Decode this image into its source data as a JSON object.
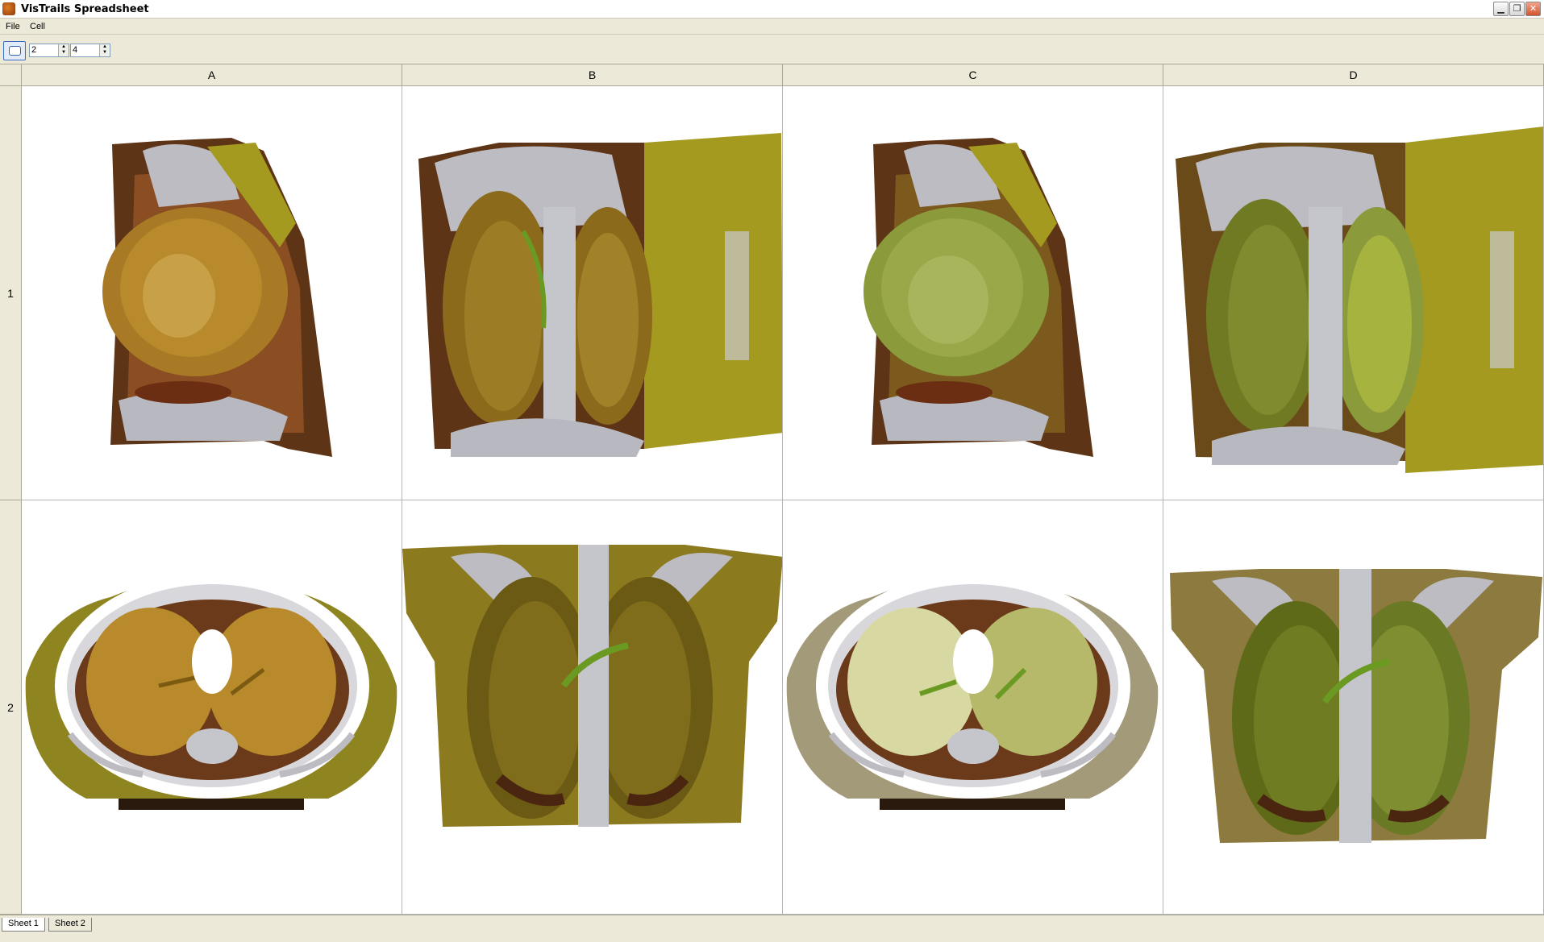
{
  "window": {
    "title": "VisTrails Spreadsheet"
  },
  "menu": [
    "File",
    "Cell"
  ],
  "toolbar": {
    "rows_value": "2",
    "cols_value": "4"
  },
  "grid": {
    "columns": [
      "A",
      "B",
      "C",
      "D"
    ],
    "rows": [
      "1",
      "2"
    ]
  },
  "tabs": [
    {
      "label": "Sheet 1",
      "active": true
    },
    {
      "label": "Sheet 2",
      "active": false
    }
  ],
  "colors": {
    "skin_olive": "#a39a1f",
    "lung_amber": "#b88a2b",
    "lung_green": "#8b9a3b",
    "bone_gray": "#bcbcc2",
    "flesh_brown": "#6b3a1a"
  }
}
